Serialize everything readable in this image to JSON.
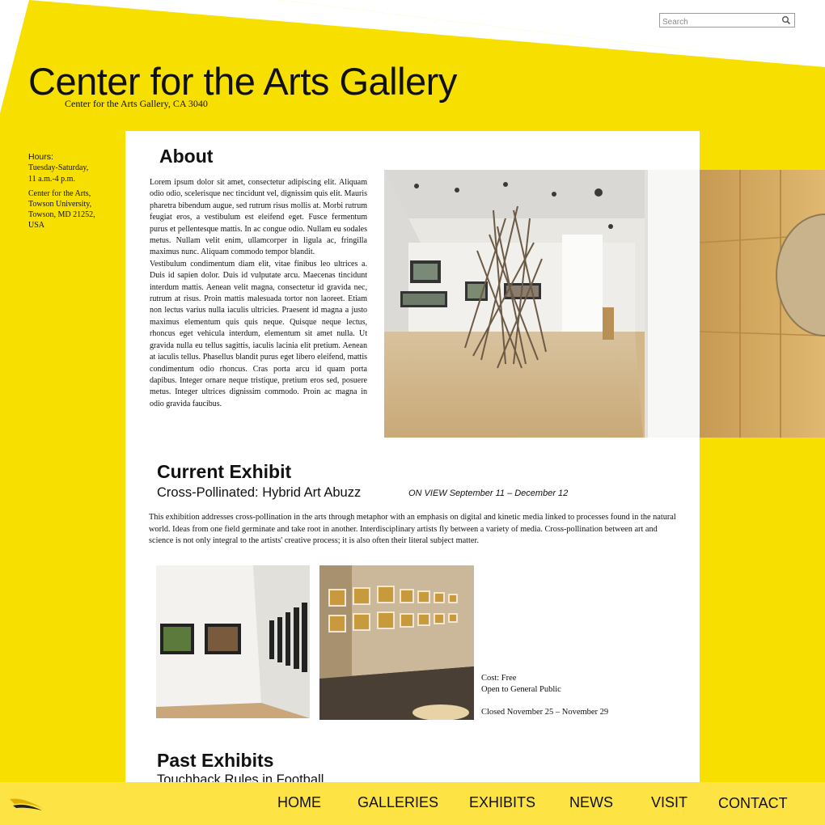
{
  "header": {
    "title": "Center for the Arts Gallery",
    "subtitle": "Center for the Arts Gallery, CA 3040",
    "search_placeholder": "Search"
  },
  "hours": {
    "label": "Hours:",
    "days": "Tuesday-Saturday,",
    "time": "11 a.m.-4 p.m.",
    "address_lines": [
      "Center for the Arts,",
      "Towson University,",
      "Towson, MD 21252,",
      "USA"
    ]
  },
  "about": {
    "title": "About",
    "paragraphs": [
      "Lorem ipsum dolor sit amet, consectetur adipiscing elit. Aliquam odio odio, scelerisque nec tincidunt vel, dignissim quis elit. Mauris pharetra bibendum augue, sed rutrum risus mollis at. Morbi rutrum feugiat eros, a vestibulum est eleifend eget. Fusce fermentum purus et pellentesque mattis. In ac congue odio. Nullam eu sodales metus. Nullam velit enim, ullamcorper in ligula ac, fringilla maximus nunc. Aliquam commodo tempor blandit.",
      "Vestibulum condimentum diam elit, vitae finibus leo ultrices a. Duis id sapien dolor. Duis id vulputate arcu. Maecenas tincidunt interdum mattis. Aenean velit magna, consectetur id gravida nec, rutrum at risus. Proin mattis malesuada tortor non laoreet. Etiam non lectus varius nulla iaculis ultricies. Praesent id magna a justo maximus elementum quis quis neque. Quisque neque lectus, rhoncus eget vehicula interdum, elementum sit amet nulla. Ut gravida nulla eu tellus sagittis, iaculis lacinia elit pretium. Aenean at iaculis tellus. Phasellus blandit purus eget libero eleifend, mattis condimentum odio rhoncus. Cras porta arcu id quam porta dapibus. Integer ornare neque tristique, pretium eros sed, posuere metus. Integer ultrices dignissim commodo. Proin ac magna in odio gravida faucibus."
    ]
  },
  "current_exhibit": {
    "heading": "Current Exhibit",
    "name": "Cross-Pollinated: Hybrid Art Abuzz",
    "dates": "ON VIEW September 11 – December 12",
    "description": "This exhibition addresses cross-pollination in the arts through metaphor with an emphasis on digital and kinetic media linked to processes found in the natural world. Ideas from one field germinate and take root in another. Interdisciplinary artists fly between a variety of media. Cross-pollination between art and science is not only integral to the artists' creative process; it is also often their literal subject matter.",
    "cost": "Cost: Free",
    "access": "Open to General Public",
    "closed": "Closed November 25 – November 29"
  },
  "past_exhibits": {
    "heading": "Past Exhibits",
    "first_item": "Touchback Rules in Football"
  },
  "nav": {
    "items": [
      "HOME",
      "GALLERIES",
      "EXHIBITS",
      "NEWS",
      "VISIT",
      "CONTACT"
    ]
  },
  "colors": {
    "brand_yellow": "#f7df00",
    "footer_yellow": "#fde343",
    "text": "#111111"
  },
  "icons": {
    "search": "magnifier-icon",
    "logo": "swoosh-logo-icon"
  }
}
